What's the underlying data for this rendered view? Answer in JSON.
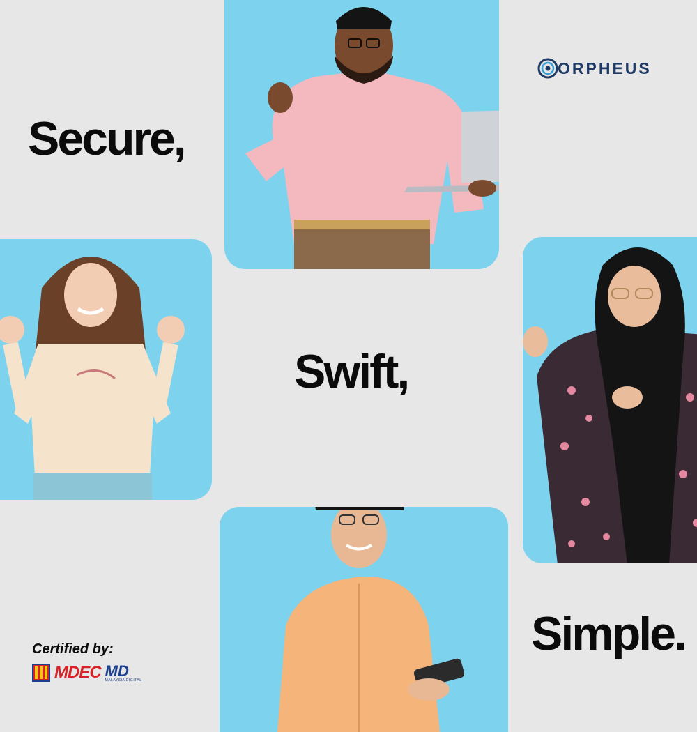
{
  "headlines": {
    "line1": "Secure,",
    "line2": "Swift,",
    "line3": "Simple."
  },
  "brand": {
    "logo_text": "ORPHEUS",
    "color": "#1f3a64",
    "icon": "orpheus-ring-icon"
  },
  "certification": {
    "label": "Certified by:",
    "badges": [
      "MDEC",
      "MD"
    ],
    "badge_icons": [
      "malaysia-flag-icon"
    ],
    "md_subtitle": "MALAYSIA DIGITAL"
  },
  "colors": {
    "background": "#e7e7e8",
    "card": "#7dd3ee",
    "text": "#0b0b0b",
    "mdec_red": "#d92128",
    "mdec_blue": "#1a3f8f"
  },
  "photos": [
    {
      "name": "man-pink-baju-melayu-laptop",
      "position": "top-center"
    },
    {
      "name": "woman-cream-blouse",
      "position": "left"
    },
    {
      "name": "woman-hijab-floral",
      "position": "right"
    },
    {
      "name": "man-orange-baju-melayu-phone",
      "position": "bottom-center"
    }
  ]
}
